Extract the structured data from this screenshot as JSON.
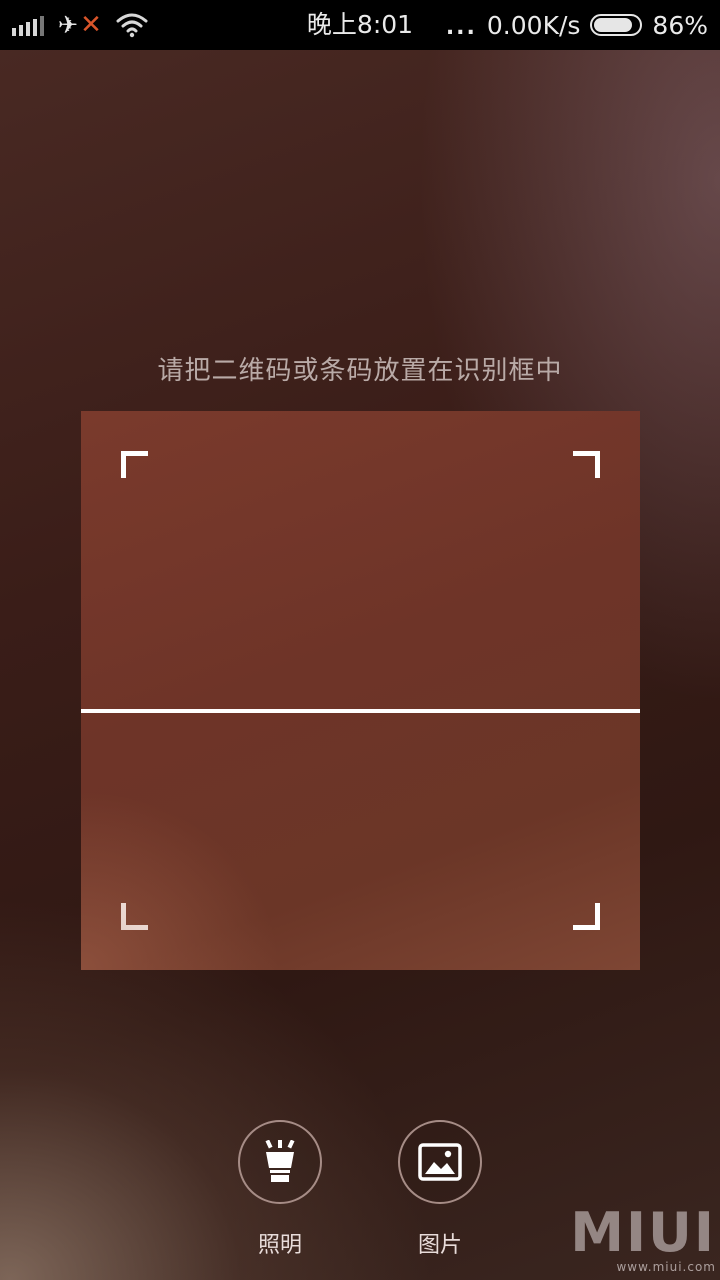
{
  "status_bar": {
    "time": "晚上8:01",
    "more_dots": "...",
    "network_speed": "0.00K/s",
    "battery_percent": "86%",
    "battery_level": 0.86,
    "icons": [
      "signal-icon",
      "airplane-icon",
      "no-connection-icon",
      "wifi-icon",
      "battery-icon"
    ]
  },
  "scanner": {
    "hint": "请把二维码或条码放置在识别框中"
  },
  "actions": {
    "light_label": "照明",
    "photo_label": "图片"
  },
  "watermark": {
    "logo": "MIUI",
    "url": "www.miui.com"
  },
  "colors": {
    "scan_corner": "#ffffff",
    "scan_frame": "#6e3428",
    "airplane_x": "#d9552a"
  }
}
